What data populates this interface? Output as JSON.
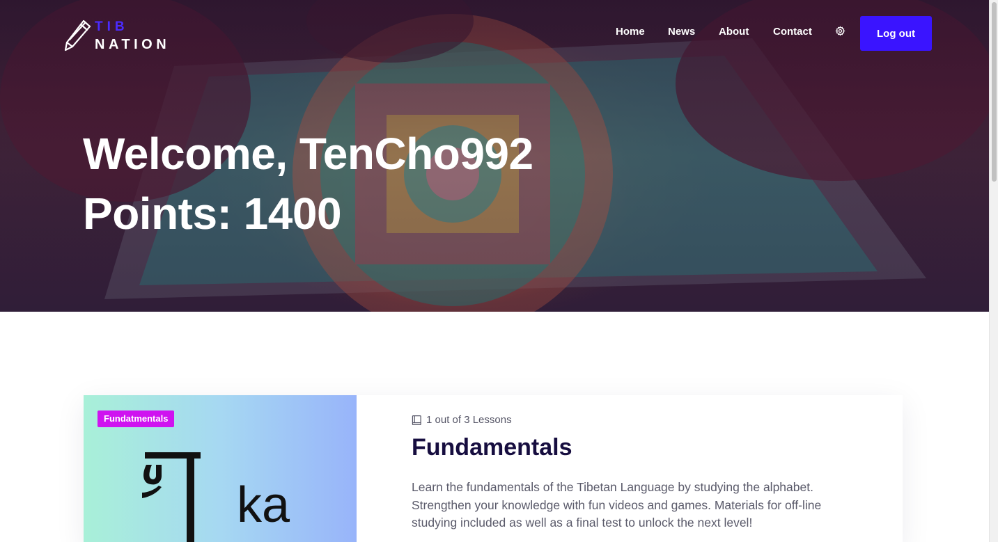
{
  "brand": {
    "line1": "TIB",
    "line2": "NATION",
    "accent_color": "#4b2cff"
  },
  "nav": {
    "items": [
      {
        "label": "Home"
      },
      {
        "label": "News"
      },
      {
        "label": "About"
      },
      {
        "label": "Contact"
      }
    ],
    "settings_icon": "gear-icon",
    "logout_label": "Log out",
    "logout_color": "#3a14ff"
  },
  "hero": {
    "welcome": "Welcome, TenCho992",
    "points": "Points: 1400"
  },
  "course": {
    "tag": "Fundatmentals",
    "tag_color": "#cf13f0",
    "image_letter": "ka",
    "lessons_icon": "book-icon",
    "lessons": "1 out of 3 Lessons",
    "title": "Fundamentals",
    "description": "Learn the fundamentals of the Tibetan Language by studying the alphabet. Strengthen your knowledge with fun videos and games. Materials for off-line studying included as well as a final test to unlock the next level!"
  }
}
